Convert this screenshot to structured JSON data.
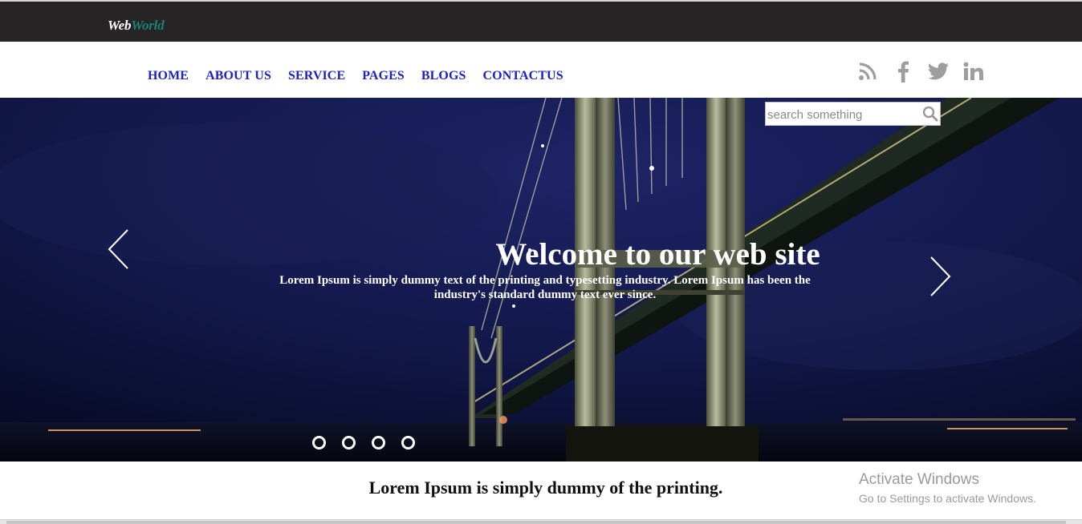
{
  "logo": {
    "part1": "Web",
    "part2": "World"
  },
  "nav": {
    "items": [
      {
        "label": "HOME"
      },
      {
        "label": "ABOUT US"
      },
      {
        "label": "SERVICE"
      },
      {
        "label": "PAGES"
      },
      {
        "label": "BLOGS"
      },
      {
        "label": "CONTACTUS"
      }
    ]
  },
  "social": {
    "icons": [
      "rss-icon",
      "facebook-icon",
      "twitter-icon",
      "linkedin-icon"
    ]
  },
  "search": {
    "placeholder": "search something",
    "value": ""
  },
  "hero": {
    "title": "Welcome to our web site",
    "text": "Lorem Ipsum is simply dummy text of the printing and typesetting industry. Lorem Ipsum has been the industry's standard dummy text ever since.",
    "slide_count": 4
  },
  "section": {
    "heading": "Lorem Ipsum is simply dummy of the printing."
  },
  "windows_watermark": {
    "title": "Activate Windows",
    "subtitle": "Go to Settings to activate Windows."
  },
  "colors": {
    "topbar": "#262424",
    "nav_link": "#1a22c8",
    "logo_accent": "#1d8077",
    "icon_gray": "#9e9e9e"
  }
}
